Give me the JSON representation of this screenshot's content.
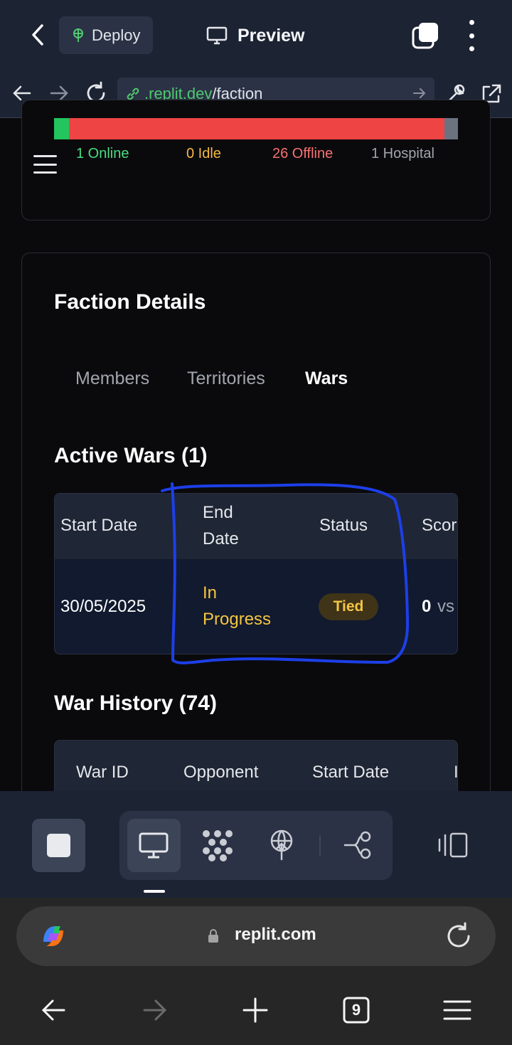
{
  "topbar": {
    "deploy_label": "Deploy",
    "preview_label": "Preview"
  },
  "address": {
    "url_host": ".replit.dev",
    "url_path": "/faction"
  },
  "status_summary": {
    "online": "1 Online",
    "idle": "0 Idle",
    "offline": "26 Offline",
    "hospital": "1 Hospital",
    "colors": {
      "online": "#22c55e",
      "idle": "#f5b942",
      "offline": "#ef4444",
      "hospital": "#9ca3af"
    }
  },
  "faction_details": {
    "title": "Faction Details",
    "tabs": [
      {
        "label": "Members",
        "active": false
      },
      {
        "label": "Territories",
        "active": false
      },
      {
        "label": "Wars",
        "active": true
      }
    ]
  },
  "active_wars": {
    "title": "Active Wars (1)",
    "headers": {
      "start_date": "Start Date",
      "end_date_1": "End",
      "end_date_2": "Date",
      "status": "Status",
      "score": "Scor"
    },
    "row": {
      "start_date": "30/05/2025",
      "end_date_1": "In",
      "end_date_2": "Progress",
      "status": "Tied",
      "score_left": "0",
      "score_vs": "vs"
    }
  },
  "war_history": {
    "title": "War History (74)",
    "headers": {
      "war_id": "War ID",
      "opponent": "Opponent",
      "start_date": "Start Date",
      "next": "I"
    }
  },
  "browser": {
    "domain": "replit.com",
    "tab_count": "9"
  },
  "icons": {
    "back": "chevron-left-icon",
    "deploy": "deploy-icon",
    "preview": "monitor-icon",
    "tabs": "tabs-overlap-icon",
    "menu": "kebab-menu-icon"
  }
}
